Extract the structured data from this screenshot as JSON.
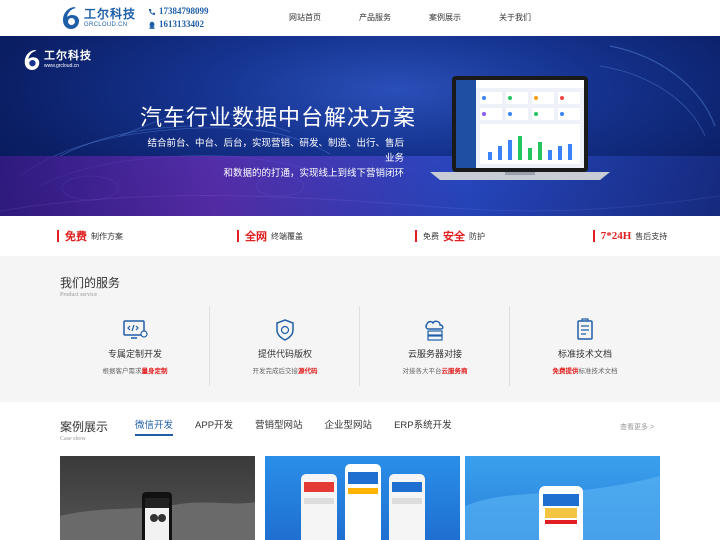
{
  "header": {
    "logo_cn": "工尔科技",
    "logo_en": "GRCLOUD.CN",
    "phone1": "17384798099",
    "phone2": "1613133402",
    "nav": [
      "网站首页",
      "产品服务",
      "案例展示",
      "关于我们"
    ]
  },
  "banner": {
    "logo_cn": "工尔科技",
    "logo_en": "www.grcloud.cn",
    "title": "汽车行业数据中台解决方案",
    "subtitle_line1": "结合前台、中台、后台，实现营销、研发、制造、出行、售后业务",
    "subtitle_line2": "和数据的的打通，实现线上到线下营销闭环"
  },
  "features": [
    {
      "highlight": "免费",
      "text": "制作方案"
    },
    {
      "highlight": "全网",
      "text": "终端覆盖"
    },
    {
      "pre": "免费",
      "highlight": "安全",
      "text": "防护"
    },
    {
      "highlight": "7*24H",
      "text": "售后支持"
    }
  ],
  "services": {
    "title": "我们的服务",
    "subtitle": "Product service",
    "items": [
      {
        "icon": "code-monitor-icon",
        "name": "专属定制开发",
        "desc_pre": "根据客户需求",
        "desc_red": "量身定制",
        "desc_post": ""
      },
      {
        "icon": "shield-copyright-icon",
        "name": "提供代码版权",
        "desc_pre": "开发完成后交接",
        "desc_red": "源代码",
        "desc_post": ""
      },
      {
        "icon": "cloud-server-icon",
        "name": "云服务器对接",
        "desc_pre": "对接各大平台",
        "desc_red": "云服务商",
        "desc_post": ""
      },
      {
        "icon": "document-icon",
        "name": "标准技术文档",
        "desc_pre": "",
        "desc_red": "免费提供",
        "desc_post": "标准技术文档"
      }
    ]
  },
  "cases": {
    "title": "案例展示",
    "subtitle": "Case show",
    "tabs": [
      "微信开发",
      "APP开发",
      "营销型网站",
      "企业型网站",
      "ERP系统开发"
    ],
    "more": "查看更多 >"
  },
  "colors": {
    "brand_blue": "#1f5fa8",
    "accent_red": "#e02020"
  }
}
